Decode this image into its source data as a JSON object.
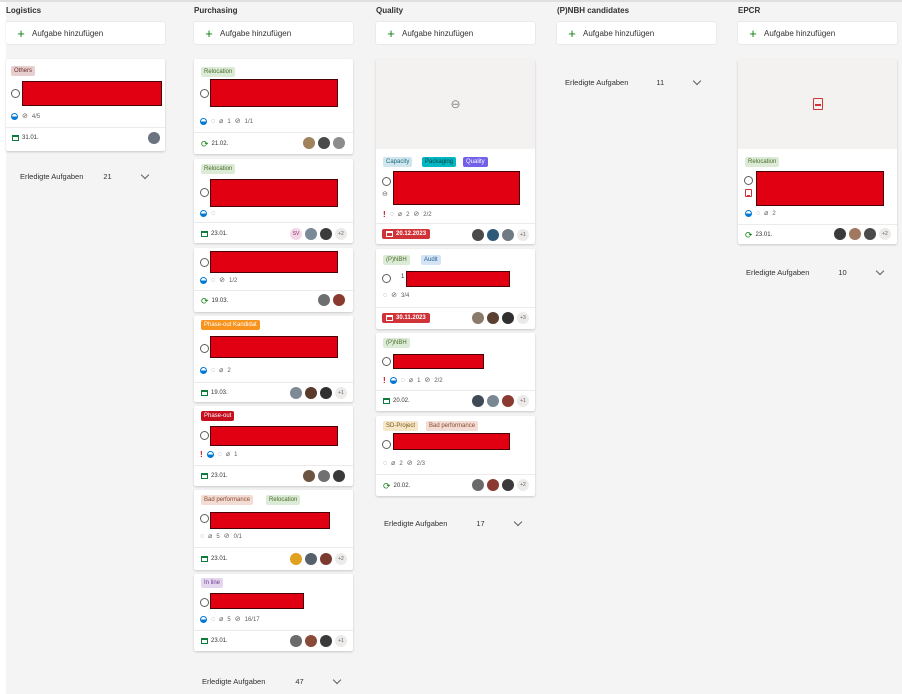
{
  "add_label": "Aufgabe hinzufügen",
  "columns": [
    {
      "title": "Logistics",
      "done_label": "Erledigte Aufgaben",
      "done_count": "21"
    },
    {
      "title": "Purchasing",
      "done_label": "Erledigte Aufgaben",
      "done_count": "47"
    },
    {
      "title": "Quality",
      "done_label": "Erledigte Aufgaben",
      "done_count": "17"
    },
    {
      "title": "(P)NBH candidates",
      "done_label": "Erledigte Aufgaben",
      "done_count": "11"
    },
    {
      "title": "EPCR",
      "done_label": "Erledigte Aufgaben",
      "done_count": "10"
    }
  ],
  "cards": {
    "log1": {
      "tags": [
        "Others"
      ],
      "checklist": "4/5",
      "date": "31.01."
    },
    "pur1": {
      "tags": [
        "Relocation"
      ],
      "attachments": "1",
      "checklist": "1/1",
      "date": "21.02."
    },
    "pur2": {
      "tags": [
        "Relocation"
      ],
      "date": "23.01.",
      "initials": "SV",
      "more": "+2"
    },
    "pur3": {
      "checklist": "1/2",
      "date": "19.03."
    },
    "pur4": {
      "tags": [
        "Phase-out Kandidat"
      ],
      "attachments": "2",
      "date": "19.03.",
      "more": "+1"
    },
    "pur5": {
      "tags": [
        "Phase-out"
      ],
      "attachments": "1",
      "date": "23.01."
    },
    "pur6": {
      "tags": [
        "Bad performance",
        "Relocation"
      ],
      "attachments": "5",
      "checklist": "0/1",
      "date": "23.01.",
      "more": "+2"
    },
    "pur7": {
      "tags": [
        "In line"
      ],
      "attachments": "5",
      "checklist": "16/17",
      "date": "23.01.",
      "more": "+1"
    },
    "qua1": {
      "tags": [
        "Capacity",
        "Packaging",
        "Quality"
      ],
      "attachments": "2",
      "checklist": "2/2",
      "date": "20.12.2023",
      "more": "+1"
    },
    "qua2": {
      "tags": [
        "(P)NBH",
        "Audit"
      ],
      "prefix": "1",
      "checklist": "3/4",
      "date": "30.11.2023",
      "more": "+3"
    },
    "qua3": {
      "tags": [
        "(P)NBH"
      ],
      "attachments": "1",
      "checklist": "2/2",
      "date": "20.02.",
      "more": "+1"
    },
    "qua4": {
      "tags": [
        "SD-Project",
        "Bad performance"
      ],
      "attachments": "2",
      "checklist": "2/3",
      "date": "20.02.",
      "more": "+2"
    },
    "epc1": {
      "tags": [
        "Relocation"
      ],
      "attachments": "2",
      "date": "23.01.",
      "more": "+2"
    }
  },
  "colors": {
    "accent": "#107c10",
    "overdue": "#d13438",
    "redaction": "#e00011"
  }
}
